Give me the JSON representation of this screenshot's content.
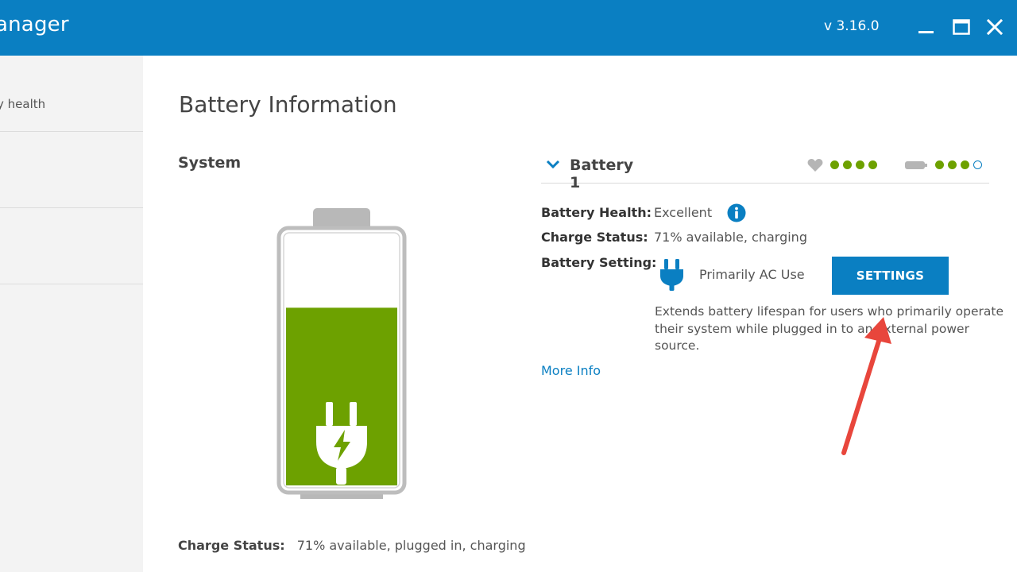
{
  "window": {
    "title": "anager",
    "version": "v 3.16.0",
    "accent_color": "#0a7fc2",
    "controls": [
      "minimize-icon",
      "maximize-icon",
      "close-icon"
    ]
  },
  "sidebar": {
    "items": [
      {
        "label": "y health"
      },
      {
        "label": ""
      },
      {
        "label": ""
      }
    ]
  },
  "main": {
    "title": "Battery Information",
    "system": {
      "label": "System",
      "charge_percent": 71,
      "fill_color": "#6da100",
      "charge_status_label": "Charge Status:",
      "charge_status_value": "71% available, plugged in, charging"
    },
    "battery1": {
      "title": "Battery 1",
      "health_indicator": {
        "icon": "heart-icon",
        "filled": 4,
        "total": 4
      },
      "charge_indicator": {
        "icon": "battery-small-icon",
        "filled": 3,
        "total": 4
      },
      "rows": {
        "health_label": "Battery Health:",
        "health_value": "Excellent",
        "charge_label": "Charge Status:",
        "charge_value": "71% available, charging",
        "setting_label": "Battery Setting:",
        "setting_value": "Primarily AC Use"
      },
      "settings_button": "SETTINGS",
      "setting_description": "Extends battery lifespan for users who primarily operate their system while plugged in to an external power source.",
      "more_info": "More Info"
    }
  },
  "annotation": {
    "type": "red-arrow",
    "color": "#e8463c"
  }
}
